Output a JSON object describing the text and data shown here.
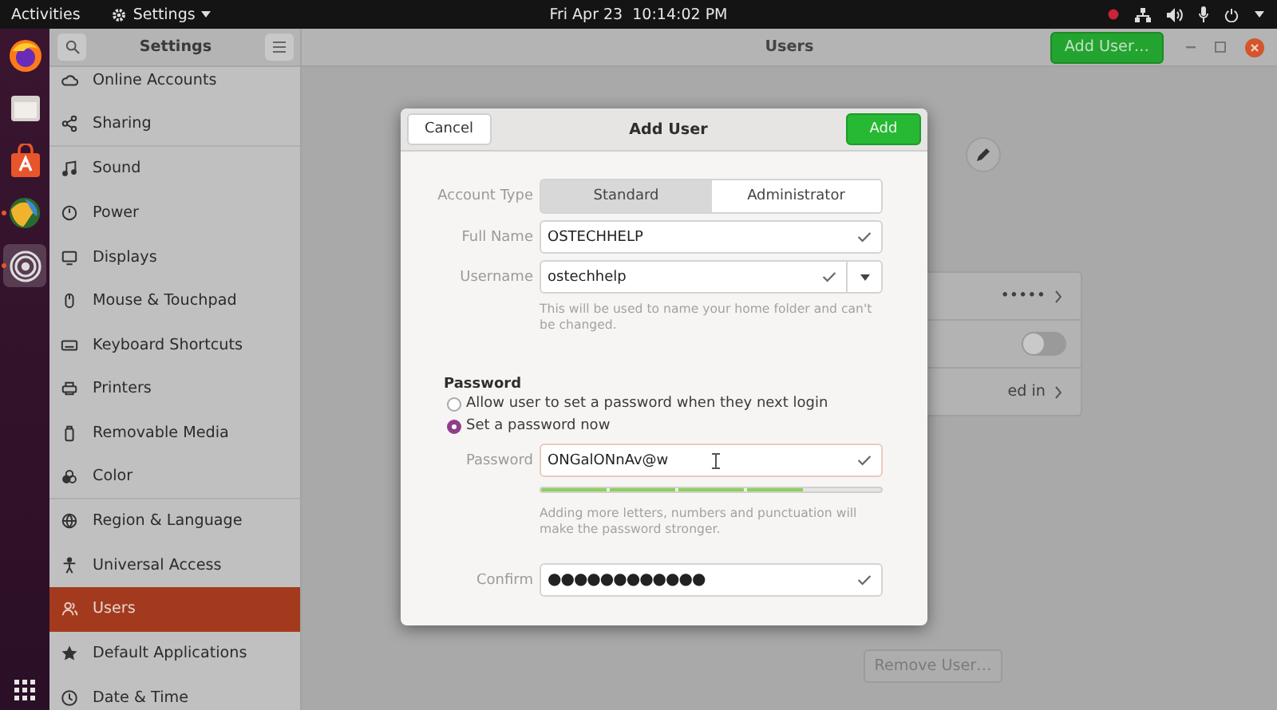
{
  "top_bar": {
    "activities": "Activities",
    "app_menu": "Settings",
    "clock": "Fri Apr 23  10:14:02 PM"
  },
  "dock": [
    {
      "kind": "browser",
      "running": false,
      "selected": false
    },
    {
      "kind": "files",
      "running": false,
      "selected": false
    },
    {
      "kind": "store",
      "running": false,
      "selected": false
    },
    {
      "kind": "globe",
      "running": true,
      "selected": false
    },
    {
      "kind": "settings",
      "running": true,
      "selected": true
    }
  ],
  "sidebar": {
    "title": "Settings",
    "items": [
      {
        "label": "Online Accounts",
        "kind": "cloud",
        "selected": false
      },
      {
        "label": "Sharing",
        "kind": "share",
        "selected": false,
        "divider": true
      },
      {
        "label": "Sound",
        "kind": "music",
        "selected": false
      },
      {
        "label": "Power",
        "kind": "power",
        "selected": false
      },
      {
        "label": "Displays",
        "kind": "display",
        "selected": false
      },
      {
        "label": "Mouse & Touchpad",
        "kind": "mouse",
        "selected": false
      },
      {
        "label": "Keyboard Shortcuts",
        "kind": "keyboard",
        "selected": false
      },
      {
        "label": "Printers",
        "kind": "printer",
        "selected": false
      },
      {
        "label": "Removable Media",
        "kind": "media",
        "selected": false
      },
      {
        "label": "Color",
        "kind": "color",
        "selected": false,
        "divider": true
      },
      {
        "label": "Region & Language",
        "kind": "globe",
        "selected": false
      },
      {
        "label": "Universal Access",
        "kind": "access",
        "selected": false
      },
      {
        "label": "Users",
        "kind": "users",
        "selected": true
      },
      {
        "label": "Default Applications",
        "kind": "star",
        "selected": false
      },
      {
        "label": "Date & Time",
        "kind": "clock",
        "selected": false
      }
    ]
  },
  "header": {
    "title": "Users",
    "add_button": "Add User…"
  },
  "users_panel": {
    "rows": [
      {
        "kind": "text",
        "text": "•••••"
      },
      {
        "kind": "toggle",
        "on": false
      },
      {
        "kind": "text",
        "text": "ed in"
      }
    ],
    "remove_button": "Remove User…"
  },
  "dialog": {
    "title": "Add User",
    "cancel": "Cancel",
    "add": "Add",
    "account_type": {
      "label": "Account Type",
      "options": [
        {
          "label": "Standard",
          "selected": true
        },
        {
          "label": "Administrator",
          "selected": false
        }
      ]
    },
    "full_name": {
      "label": "Full Name",
      "value": "OSTECHHELP"
    },
    "username": {
      "label": "Username",
      "value": "ostechhelp",
      "hint": "This will be used to name your home folder and can't be changed."
    },
    "password_section": {
      "title": "Password",
      "options": [
        {
          "label": "Allow user to set a password when they next login",
          "selected": false
        },
        {
          "label": "Set a password now",
          "selected": true
        }
      ],
      "password": {
        "label": "Password",
        "value": "ONGalONnAv@w",
        "strength": {
          "level": 0.77
        },
        "hint": "Adding more letters, numbers and punctuation will make the password stronger."
      },
      "confirm": {
        "label": "Confirm",
        "value": "●●●●●●●●●●●●"
      }
    }
  }
}
